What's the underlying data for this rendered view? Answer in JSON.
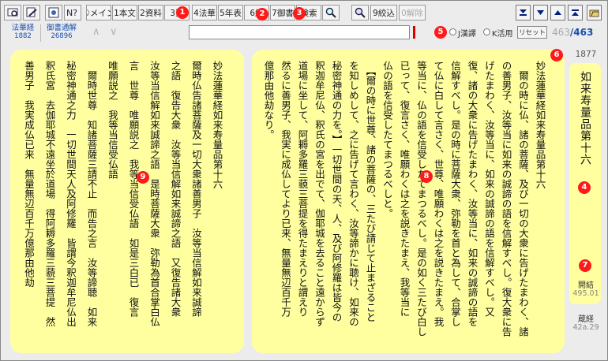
{
  "toolbar": {
    "icon_buttons_left": [
      "search-tool-icon",
      "edit-icon",
      "settings-icon",
      "help-icon"
    ],
    "buttons": [
      {
        "key": "main",
        "label": "①メイン"
      },
      {
        "key": "honbun",
        "label": "1本文"
      },
      {
        "key": "shiryo",
        "label": "2資料"
      },
      {
        "key": "sen",
        "label": "3選"
      },
      {
        "key": "hokke",
        "label": "4法華"
      },
      {
        "key": "nenpyo",
        "label": "5年表"
      },
      {
        "key": "kei",
        "label": "6経"
      },
      {
        "key": "gosho",
        "label": "7御書"
      },
      {
        "key": "kensaku",
        "label": "検索"
      },
      {
        "key": "shibori",
        "label": "9絞込"
      },
      {
        "key": "kaijo",
        "label": "0解除"
      }
    ],
    "markers": [
      "1",
      "2",
      "3"
    ]
  },
  "subbar": {
    "sutra_label": "法華経",
    "sutra_page": "1882",
    "gosho_label": "御書通解",
    "gosho_page": "26896",
    "prev_arrow": "∧",
    "next_arrow": "∨",
    "search_value": "",
    "radio1_label": "J漢譯",
    "radio2_label": "K活用",
    "reset_label": "リセット",
    "count_current": "463",
    "count_total": "/463",
    "marker": "5"
  },
  "right_panel": {
    "marker": "8",
    "columns": [
      "妙法蓮華経如来寿量品第十六",
      "　爾の時に仏、諸の菩薩、及び一切の大衆に告げたまわく、諸",
      "の善男子、汝等当に如来の誠諦の語を信解すべし。復大衆に告",
      "げたまわく、汝等当に、如来の誠諦の語を信解すべし。又",
      "復、諸の大衆に告げたまわく、汝等当に、如来の誠諦の語を",
      "信解すべし。是の時に菩薩大衆、弥勒を首と為して、合掌し",
      "て仏に白して言さく、世尊、唯願わくは之を説きたまえ。我",
      "等当に、仏の語を信受したてまつるべし。是の如く三たび白し",
      "已って、復言さく、唯願わくは之を説きたまえ、我等当に",
      "仏の語を信受したてまつるべしと。",
      "　【爾の時に世尊、諸の菩薩の、三たび請じて止まざること",
      "を知しめして、之に告げて言わく、汝等諦かに聴け、如来の",
      "秘密神通の力を。】一切世間の天、人、及び阿修羅は皆今の",
      "釈迦牟尼仏、釈氏の宮を出でて、伽耶城を去ること遠からず",
      "道場に坐して、阿耨多羅三藐三菩提を得たまえりと謂えり",
      "然るに善男子、我実に成仏してより已来、無量無辺百千万",
      "億那由他劫なり。"
    ]
  },
  "left_panel": {
    "marker": "9",
    "columns": [
      "妙法蓮華経如来寿量品第十六",
      "爾時仏告諸菩薩及一切大衆諸善男子　汝等当信解如来誠諦",
      "之語　復告大衆　汝等当信解如来誠諦之語　又復告諸大衆",
      "汝等当信解如来誠諦之語　是時菩薩大衆　弥勒為首合掌白仏",
      "言　世尊　唯願説之　我等当信受仏語　如是三白已　復言",
      "唯願説之　我等当信受仏語",
      "　爾時世尊　知諸菩薩三請不止　而告之言　汝等諦聴　如来",
      "秘密神通之力　一切世間天人及阿修羅　皆謂今釈迦牟尼仏出",
      "釈氏宮　去伽耶城不遠坐於道場　得阿耨多羅三藐三菩提　然",
      "善男子　我実成仏已来　無量無辺百千万億那由他劫"
    ]
  },
  "side": {
    "year": "1877",
    "year_marker": "6",
    "title": "如来寿量品第十六",
    "title_marker": "4",
    "bottom_marker": "7",
    "kaiketsu_label": "開結",
    "kaiketsu_value": "495.01",
    "zokyo_label": "蔵経",
    "zokyo_value": "42a.29"
  },
  "nav_right": [
    "arrow-bottom-icon",
    "arrow-down-icon",
    "arrow-up-icon",
    "arrow-top-icon",
    "open-folder-icon"
  ],
  "colors": {
    "panel": "#ffffa0",
    "marker": "#ff1a1a",
    "accent": "#1a4fb0"
  }
}
